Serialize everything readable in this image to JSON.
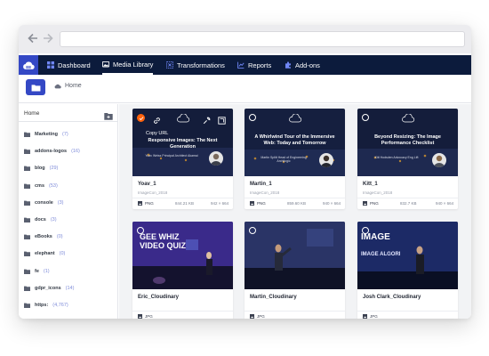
{
  "nav": {
    "items": [
      {
        "label": "Dashboard",
        "icon": "dashboard-icon"
      },
      {
        "label": "Media Library",
        "icon": "media-library-icon",
        "active": true
      },
      {
        "label": "Transformations",
        "icon": "transformations-icon"
      },
      {
        "label": "Reports",
        "icon": "reports-icon"
      },
      {
        "label": "Add-ons",
        "icon": "addons-icon"
      }
    ]
  },
  "breadcrumb": {
    "label": "Home",
    "icon": "cloud-icon"
  },
  "sidebar": {
    "title": "Home",
    "folders": [
      {
        "name": "Marketing",
        "count": "(7)"
      },
      {
        "name": "addons-logos",
        "count": "(16)"
      },
      {
        "name": "blog",
        "count": "(29)"
      },
      {
        "name": "cms",
        "count": "(53)"
      },
      {
        "name": "console",
        "count": "(3)"
      },
      {
        "name": "docs",
        "count": "(3)"
      },
      {
        "name": "eBooks",
        "count": "(0)"
      },
      {
        "name": "elephant",
        "count": "(0)"
      },
      {
        "name": "fe",
        "count": "(1)"
      },
      {
        "name": "gdpr_icons",
        "count": "(14)"
      },
      {
        "name": "https:",
        "count": "(4,767)"
      }
    ]
  },
  "assets": [
    {
      "title": "Yoav_1",
      "subtitle": "ImageCon_2018",
      "type": "PNG",
      "size": "844.21 KB",
      "dims": "942 × 664",
      "slide_title": "Responsive Images: The Next Generation",
      "slide_sub": "Yoav Weiss Principal Architect Akamai",
      "copy_url": "Copy URL",
      "selected": true
    },
    {
      "title": "Martin_1",
      "subtitle": "ImageCon_2018",
      "type": "PNG",
      "size": "859.60 KB",
      "dims": "940 × 664",
      "slide_title": "A Whirlwind Tour of the Immersive Web: Today and Tomorrow",
      "slide_sub": "Martin Splitt Head of Engineering Archilogic",
      "selected": false
    },
    {
      "title": "Kitt_1",
      "subtitle": "ImageCon_2018",
      "type": "PNG",
      "size": "832.7 KB",
      "dims": "940 × 664",
      "slide_title": "Beyond Resizing: The Image Performance Checklist",
      "slide_sub": "Kitt Hodsden Advocacy Eng Lift",
      "selected": false
    },
    {
      "title": "Eric_Cloudinary",
      "subtitle": "",
      "type": "JPG",
      "size": "",
      "dims": "",
      "selected": false
    },
    {
      "title": "Martin_Cloudinary",
      "subtitle": "",
      "type": "JPG",
      "size": "",
      "dims": "",
      "selected": false
    },
    {
      "title": "Josh Clark_Cloudinary",
      "subtitle": "",
      "type": "JPG",
      "size": "",
      "dims": "",
      "selected": false
    }
  ],
  "slide_brand": "ImageCon",
  "photo_captions": [
    "GEE WHIZ VIDEO QUIZ",
    "IMAGE",
    "IMAGE ALGORI"
  ],
  "colors": {
    "nav_bg": "#0c1b3c",
    "brand_blue": "#3448c5",
    "accent_orange": "#ff620c",
    "folder_count": "#7f8cd9",
    "grid_bg": "#f2f3f5"
  }
}
